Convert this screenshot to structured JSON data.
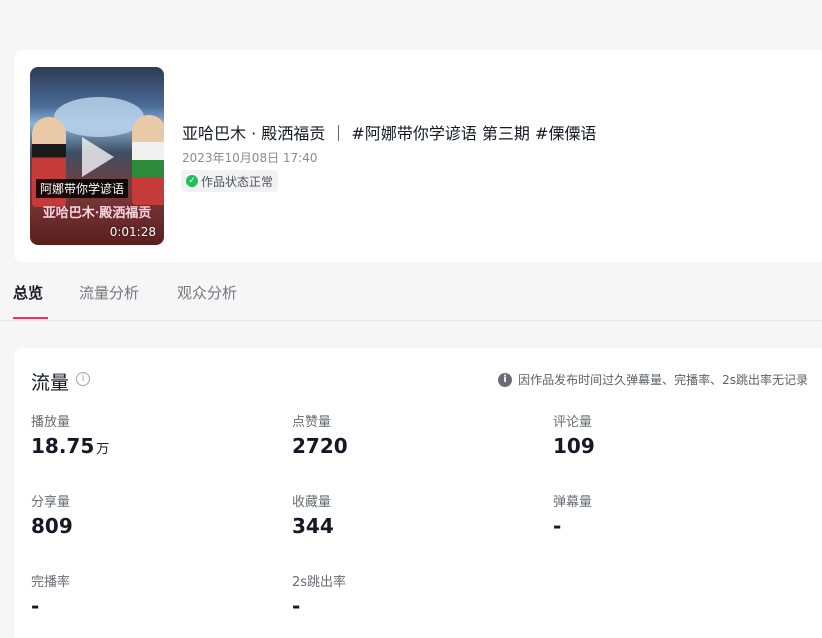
{
  "video": {
    "duration": "0:01:28",
    "thumb_caption": "阿娜带你学谚语",
    "thumb_subtitle": "亚哈巴木·殿洒福贡",
    "title": "亚哈巴木 · 殿洒福贡 ｜ #阿娜带你学谚语 第三期 #傈僳语",
    "date": "2023年10月08日 17:40",
    "status": "作品状态正常"
  },
  "tabs": [
    {
      "label": "总览",
      "active": true
    },
    {
      "label": "流量分析",
      "active": false
    },
    {
      "label": "观众分析",
      "active": false
    }
  ],
  "traffic": {
    "title": "流量",
    "note": "因作品发布时间过久弹幕量、完播率、2s跳出率无记录",
    "metrics": [
      {
        "label": "播放量",
        "value": "18.75",
        "unit": "万"
      },
      {
        "label": "点赞量",
        "value": "2720",
        "unit": ""
      },
      {
        "label": "评论量",
        "value": "109",
        "unit": ""
      },
      {
        "label": "分享量",
        "value": "809",
        "unit": ""
      },
      {
        "label": "收藏量",
        "value": "344",
        "unit": ""
      },
      {
        "label": "弹幕量",
        "value": "-",
        "unit": ""
      },
      {
        "label": "完播率",
        "value": "-",
        "unit": ""
      },
      {
        "label": "2s跳出率",
        "value": "-",
        "unit": ""
      }
    ]
  }
}
